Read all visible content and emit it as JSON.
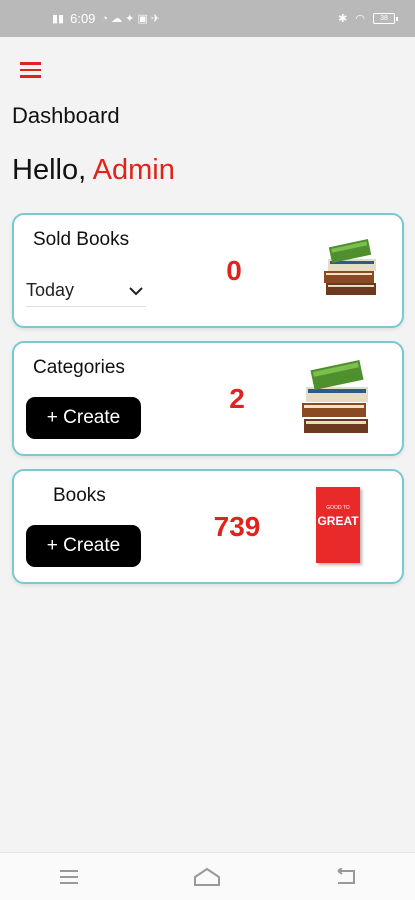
{
  "status_bar": {
    "left_signal": "⁴⁶ᴵ ᵛᵒ",
    "time": "6:09",
    "battery": "38"
  },
  "header": {
    "title": "Dashboard",
    "greeting": "Hello,",
    "user_name": "Admin"
  },
  "cards": {
    "sold_books": {
      "title": "Sold Books",
      "value": "0",
      "filter_selected": "Today"
    },
    "categories": {
      "title": "Categories",
      "value": "2",
      "create_label": "+ Create"
    },
    "books": {
      "title": "Books",
      "value": "739",
      "create_label": "+ Create",
      "cover_text": "GREAT",
      "cover_top_text": "GOOD TO"
    }
  },
  "colors": {
    "accent": "#e0231c",
    "card_border": "#7cc8d0",
    "button": "#000000"
  },
  "icons": {
    "menu": "hamburger-menu-icon",
    "dropdown": "chevron-down-icon",
    "nav_recent": "recent-apps-icon",
    "nav_home": "home-icon",
    "nav_back": "back-icon"
  }
}
